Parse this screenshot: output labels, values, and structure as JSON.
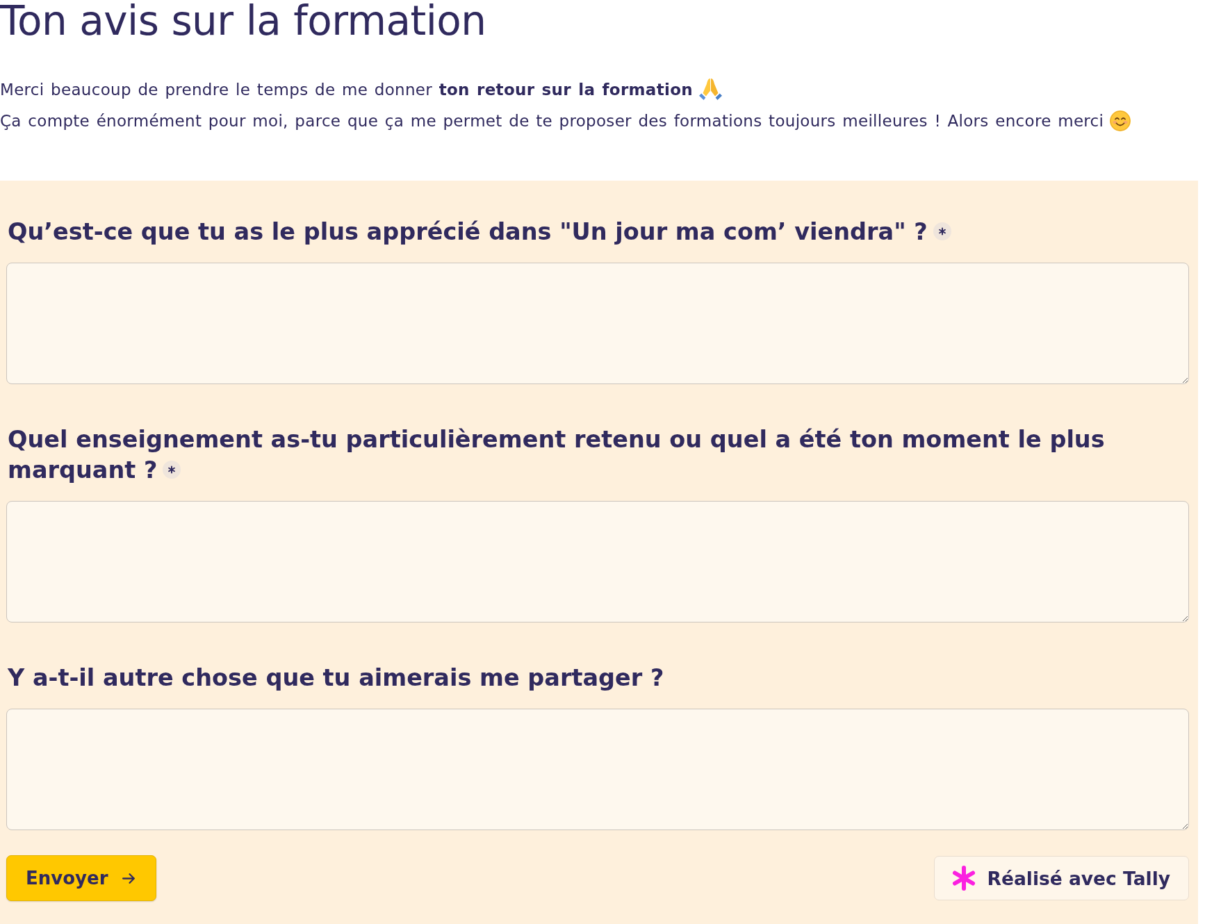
{
  "title": "Ton avis sur la formation",
  "intro": [
    "Merci beaucoup de prendre le temps de me donner **ton retour sur la formation**",
    "Ça compte énormément pour moi, parce que ça me permet de te proposer des formations toujours meilleures ! Alors encore merci"
  ],
  "questions": [
    {
      "label": "Qu’est-ce que tu as le plus apprécié dans \"Un jour ma com’ viendra\" ?",
      "required": true
    },
    {
      "label": "Quel enseignement as-tu particulièrement retenu ou quel a été ton moment le plus marquant ?",
      "required": true
    },
    {
      "label": "Y a-t-il autre chose que tu aimerais me partager ?",
      "required": false
    }
  ],
  "submit_button": {
    "label": "Envoyer"
  },
  "credit_link": {
    "label": "Réalisé avec Tally"
  }
}
